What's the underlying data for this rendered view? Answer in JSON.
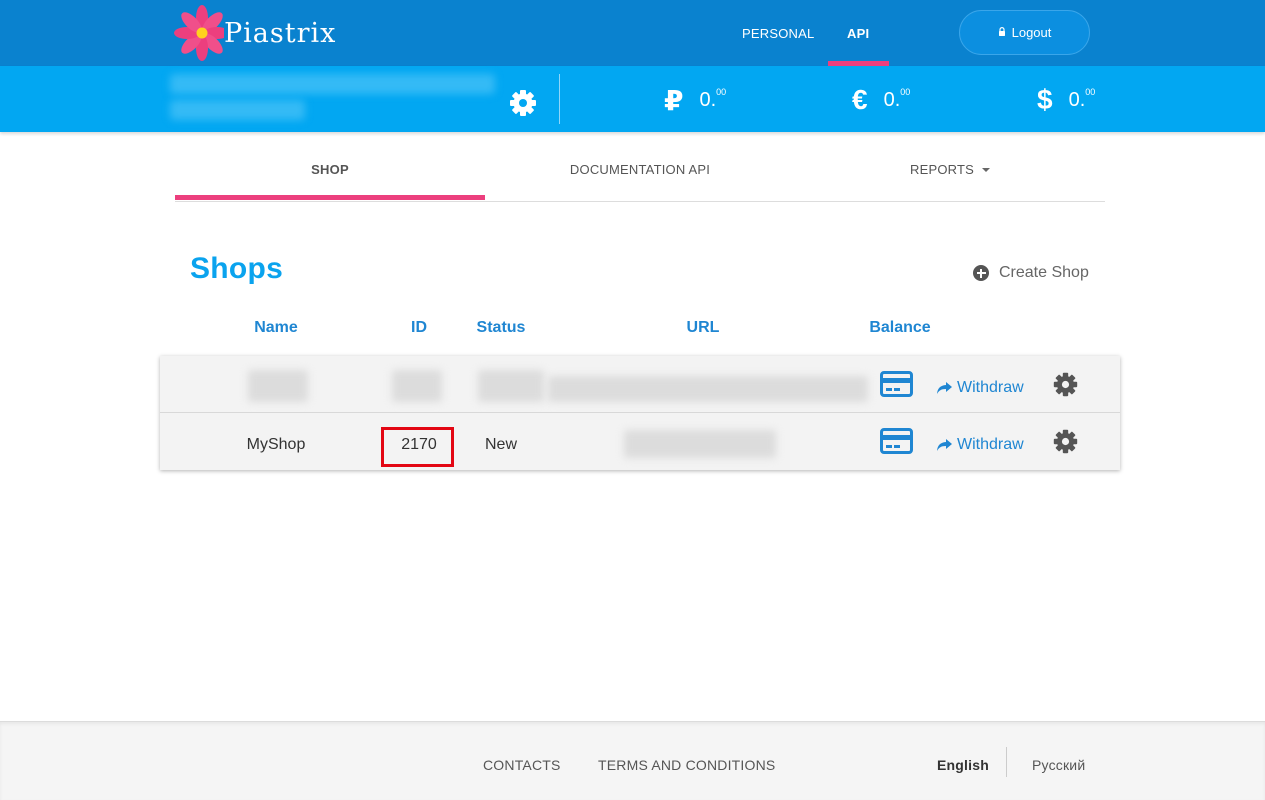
{
  "brand": {
    "name": "Piastrix"
  },
  "topnav": {
    "items": [
      {
        "label": "PERSONAL"
      },
      {
        "label": "API"
      }
    ],
    "logout_label": "Logout"
  },
  "balances": [
    {
      "currency": "RUB",
      "symbol": "₽",
      "amount": "0.",
      "decimals": "00"
    },
    {
      "currency": "EUR",
      "symbol": "€",
      "amount": "0.",
      "decimals": "00"
    },
    {
      "currency": "USD",
      "symbol": "$",
      "amount": "0.",
      "decimals": "00"
    }
  ],
  "subtabs": [
    {
      "label": "SHOP",
      "active": true
    },
    {
      "label": "DOCUMENTATION API",
      "active": false
    },
    {
      "label": "REPORTS",
      "active": false
    }
  ],
  "page": {
    "title": "Shops",
    "create_label": "Create Shop"
  },
  "table": {
    "columns": [
      "Name",
      "ID",
      "Status",
      "URL",
      "Balance"
    ],
    "rows": [
      {
        "name": "",
        "id": "",
        "status": "",
        "url": "",
        "withdraw_label": "Withdraw"
      },
      {
        "name": "MyShop",
        "id": "2170",
        "status": "New",
        "url": "",
        "withdraw_label": "Withdraw"
      }
    ]
  },
  "footer": {
    "links": [
      {
        "label": "CONTACTS"
      },
      {
        "label": "TERMS AND CONDITIONS"
      }
    ],
    "languages": [
      {
        "label": "English",
        "active": true
      },
      {
        "label": "Русский",
        "active": false
      }
    ]
  },
  "colors": {
    "topbar": "#0a82cf",
    "accountbar": "#02a7f2",
    "accent_pink": "#ec3f7e",
    "link_blue": "#1f86d2",
    "title_blue": "#0aa3ee",
    "highlight_red": "#e30613"
  }
}
